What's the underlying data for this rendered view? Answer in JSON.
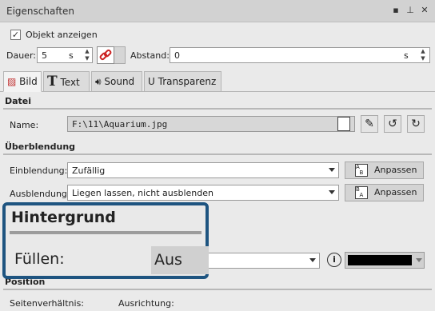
{
  "window": {
    "title": "Eigenschaften",
    "controls": [
      "▪",
      "⊥",
      "✕"
    ]
  },
  "show_object": {
    "label": "Objekt anzeigen",
    "checked": true
  },
  "dauer": {
    "label": "Dauer:",
    "value": "5",
    "unit": "s"
  },
  "abstand": {
    "label": "Abstand:",
    "value": "0",
    "unit": "s"
  },
  "tabs": [
    {
      "label": "Bild",
      "icon": "image-icon"
    },
    {
      "label": "Text",
      "icon": "text-icon"
    },
    {
      "label": "Sound",
      "icon": "speaker-icon"
    },
    {
      "label": "Transparenz",
      "icon": "magnet-icon"
    }
  ],
  "datei": {
    "section": "Datei",
    "name_label": "Name:",
    "name_value": "F:\\11\\Aquarium.jpg"
  },
  "ueberblendung": {
    "section": "Überblendung",
    "ein_label": "Einblendung:",
    "ein_value": "Zufällig",
    "aus_label": "Ausblendung:",
    "aus_value": "Liegen lassen, nicht ausblenden",
    "anpassen": "Anpassen"
  },
  "hintergrund": {
    "section": "Hintergrund",
    "fuellen_label": "Füllen:",
    "fuellen_value": "Aus",
    "color": "#000000"
  },
  "position": {
    "section": "Position",
    "seiten_label": "Seitenverhältnis:",
    "ausrichtung_label": "Ausrichtung:"
  },
  "colors": {
    "accent": "#1e5480",
    "link_icon": "#cc2222"
  }
}
